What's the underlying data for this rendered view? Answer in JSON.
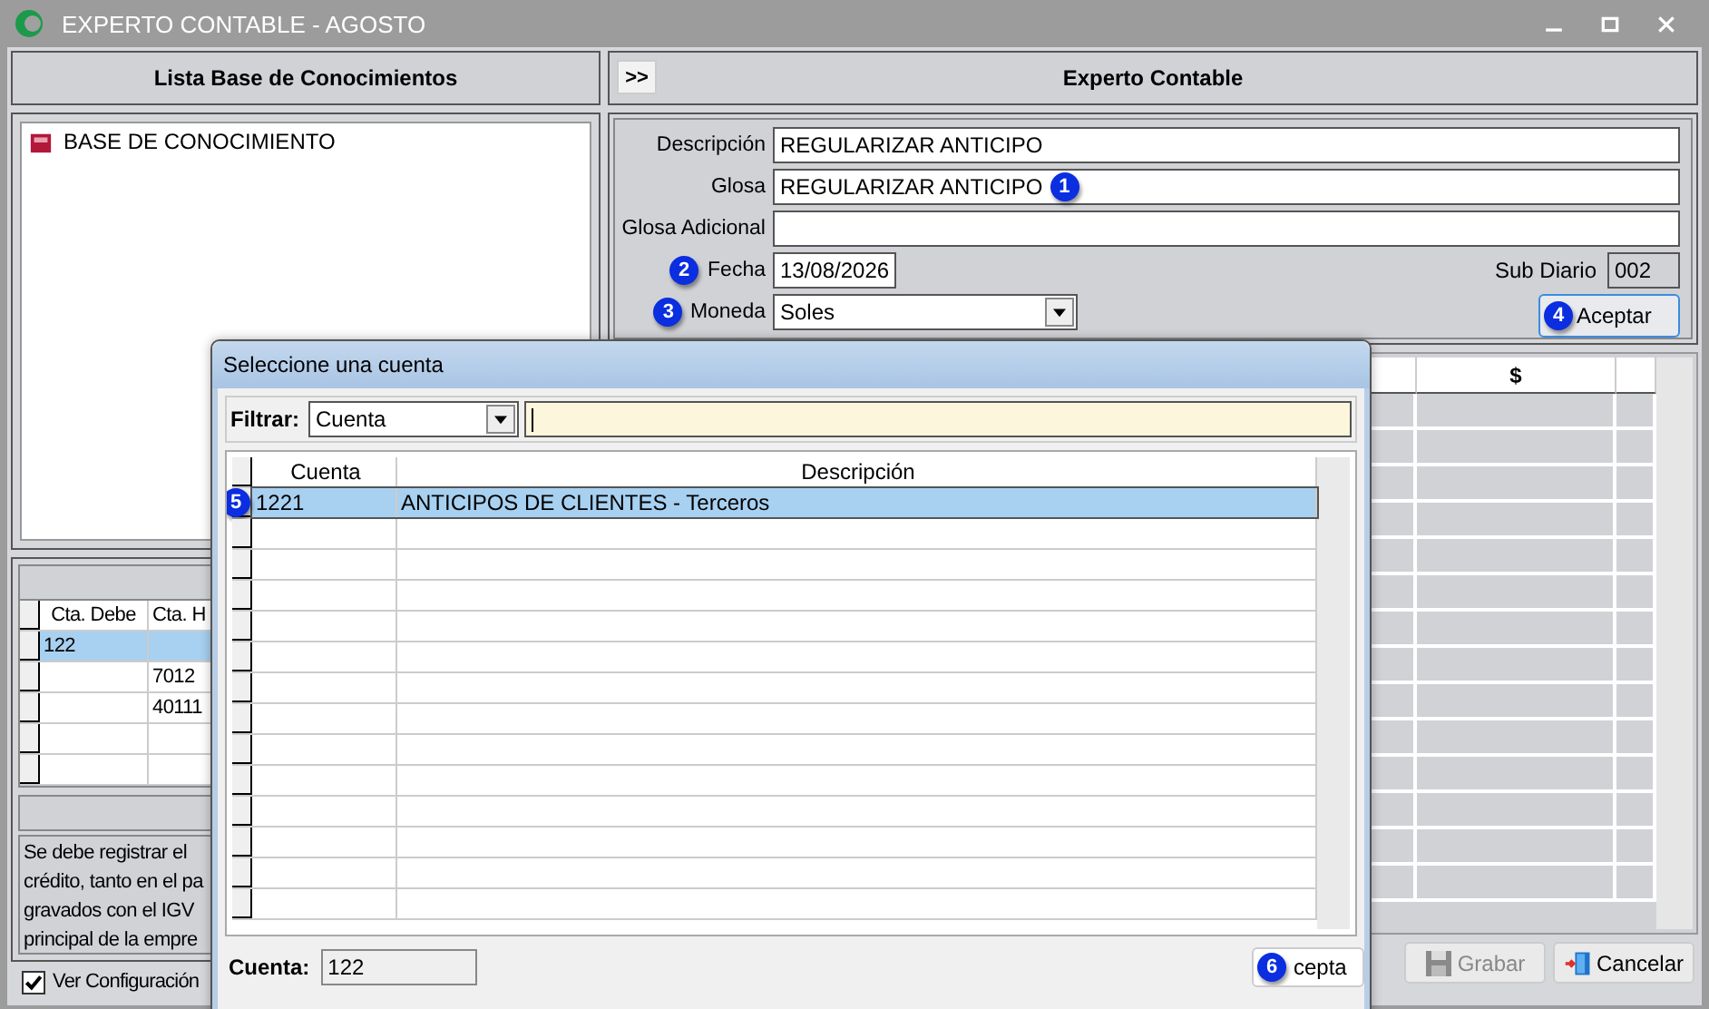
{
  "window": {
    "title": "EXPERTO CONTABLE - AGOSTO"
  },
  "left_panel": {
    "title": "Lista Base de Conocimientos",
    "tree": [
      {
        "label": "BASE DE CONOCIMIENTO",
        "selected": false
      }
    ],
    "table": {
      "columns": [
        "Cta. Debe",
        "Cta. H"
      ],
      "rows": [
        {
          "column_1": "122",
          "selected": true
        },
        {
          "column_2": "7012",
          "selected": false
        },
        {
          "column_2": "40111",
          "selected": false
        }
      ]
    },
    "note_lines": [
      "Se debe registrar el",
      "crédito, tanto en el pa",
      "gravados con el IGV",
      "principal de la empre"
    ],
    "show_config": {
      "label": "Ver Configuración",
      "checked": true
    }
  },
  "right_panel": {
    "toggle_button": ">>",
    "title": "Experto Contable",
    "form": {
      "descripcion": {
        "label": "Descripción",
        "value": "REGULARIZAR ANTICIPO"
      },
      "glosa": {
        "label": "Glosa",
        "value": "REGULARIZAR ANTICIPO",
        "marker": "1"
      },
      "glosa_adicional": {
        "label": "Glosa Adicional"
      },
      "fecha": {
        "label": "Fecha",
        "value": "13/08/2026",
        "marker": "2"
      },
      "sub_diario": {
        "label": "Sub Diario",
        "value": "002"
      },
      "moneda": {
        "label": "Moneda",
        "value": "Soles",
        "marker": "3"
      },
      "accept_button": {
        "label": "Aceptar",
        "marker": "4"
      }
    },
    "grid": {
      "columns": [
        "$"
      ]
    },
    "buttons": [
      {
        "label": "Grabar",
        "kind": "save",
        "disabled": true
      },
      {
        "label": "Cancelar",
        "kind": "cancel",
        "disabled": false
      }
    ]
  },
  "dialog": {
    "title": "Seleccione una cuenta",
    "filter": {
      "label": "Filtrar:",
      "field": "Cuenta"
    },
    "table": {
      "columns": [
        "Cuenta",
        "Descripción"
      ],
      "rows": [
        {
          "cuenta": "1221",
          "descripcion": "ANTICIPOS DE CLIENTES - Terceros",
          "selected": true,
          "marker": "5"
        }
      ]
    },
    "cuenta": {
      "label": "Cuenta:",
      "value": "122"
    },
    "accept_button": {
      "label": "cepta",
      "marker": "6"
    }
  }
}
